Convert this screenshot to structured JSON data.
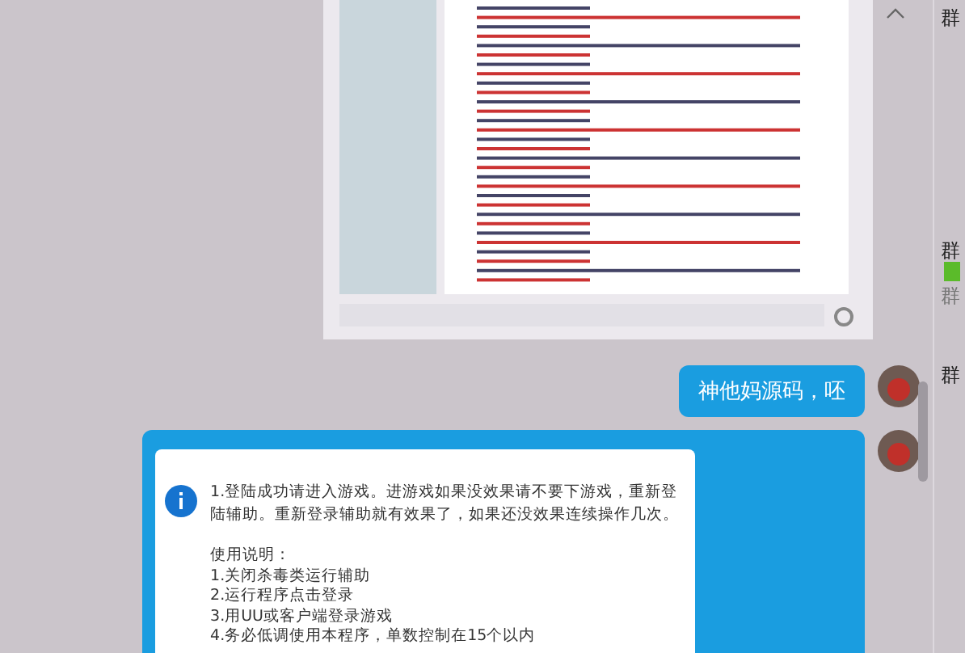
{
  "messages": [
    {
      "text": "神他妈源码，呸"
    }
  ],
  "dialog": {
    "paragraph": "1.登陆成功请进入游戏。进游戏如果没效果请不要下游戏，重新登陆辅助。重新登录辅助就有效果了，如果还没效果连续操作几次。",
    "heading": "使用说明：",
    "steps": [
      "1.关闭杀毒类运行辅助",
      "2.运行程序点击登录",
      "3.用UU或客户端登录游戏",
      "4.务必低调使用本程序，单数控制在15个以内"
    ]
  },
  "sidebar": {
    "labels": [
      "群",
      "群",
      "群",
      "群"
    ]
  }
}
